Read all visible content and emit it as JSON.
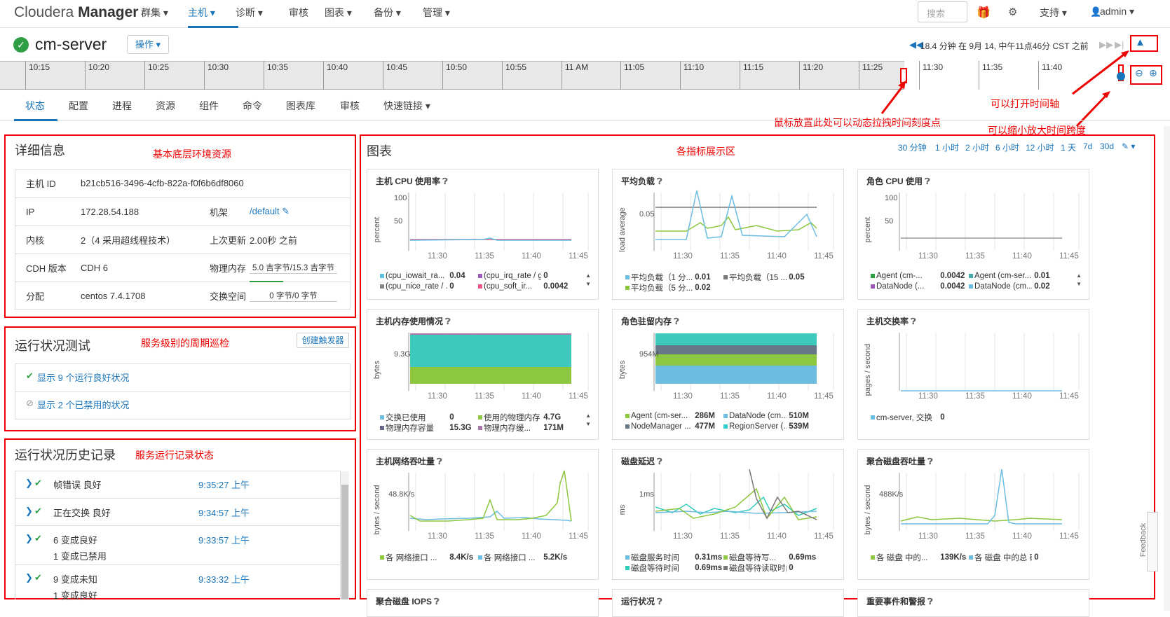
{
  "app": {
    "logo_light": "Cloudera",
    "logo_bold": "Manager"
  },
  "nav": {
    "items": [
      {
        "label": "群集 ▾",
        "active": false
      },
      {
        "label": "主机 ▾",
        "active": true
      },
      {
        "label": "诊断 ▾",
        "active": false
      },
      {
        "label": "审核",
        "active": false
      },
      {
        "label": "图表 ▾",
        "active": false
      },
      {
        "label": "备份 ▾",
        "active": false
      },
      {
        "label": "管理 ▾",
        "active": false
      }
    ],
    "search_placeholder": "搜索",
    "support": "支持 ▾",
    "user": "admin ▾"
  },
  "header": {
    "host": "cm-server",
    "actions": "操作 ▾",
    "time_info": "18.4 分钟 在 9月 14, 中午11点46分 CST 之前"
  },
  "timeline": {
    "ticks": [
      "10:15",
      "10:20",
      "10:25",
      "10:30",
      "10:35",
      "10:40",
      "10:45",
      "10:50",
      "10:55",
      "11 AM",
      "11:05",
      "11:10",
      "11:15",
      "11:20",
      "11:25",
      "11:30",
      "11:35",
      "11:40"
    ]
  },
  "tabs": [
    "状态",
    "配置",
    "进程",
    "资源",
    "组件",
    "命令",
    "图表库",
    "审核",
    "快速链接 ▾"
  ],
  "annotations": {
    "drag": "鼠标放置此处可以动态拉拽时间刻度点",
    "open_timeline": "可以打开时间轴",
    "zoom": "可以缩小放大时间跨度",
    "basic": "基本底层环境资源",
    "metrics": "各指标展示区",
    "periodic": "服务级别的周期巡检",
    "history": "服务运行记录状态"
  },
  "details": {
    "title": "详细信息",
    "rows": [
      {
        "k1": "主机 ID",
        "v1": "b21cb516-3496-4cfb-822a-f0f6b6df8060",
        "k2": "",
        "v2": ""
      },
      {
        "k1": "IP",
        "v1": "172.28.54.188",
        "k2": "机架",
        "v2": "/default ✎"
      },
      {
        "k1": "内核",
        "v1": "2（4 采用超线程技术）",
        "k2": "上次更新",
        "v2": "2.00秒 之前"
      },
      {
        "k1": "CDH 版本",
        "v1": "CDH 6",
        "k2": "物理内存",
        "v2": "5.0 吉字节/15.3 吉字节"
      },
      {
        "k1": "分配",
        "v1": "centos 7.4.1708",
        "k2": "交换空间",
        "v2": "0 字节/0 字节"
      }
    ]
  },
  "health": {
    "title": "运行状况测试",
    "create_trigger": "创建触发器",
    "good": "显示 9 个运行良好状况",
    "disabled": "显示 2 个已禁用的状况"
  },
  "history": {
    "title": "运行状况历史记录",
    "items": [
      {
        "text": "帧错误 良好",
        "sub": "",
        "time": "9:35:27 上午"
      },
      {
        "text": "正在交换 良好",
        "sub": "",
        "time": "9:34:57 上午"
      },
      {
        "text": "6 变成良好",
        "sub": "1 变成已禁用",
        "time": "9:33:57 上午"
      },
      {
        "text": "9 变成未知",
        "sub": "1 变成良好",
        "time": "9:33:32 上午"
      }
    ]
  },
  "charts_panel": {
    "title": "图表",
    "ranges": [
      "30 分钟",
      "1 小时",
      "2 小时",
      "6 小时",
      "12 小时",
      "1 天",
      "7d",
      "30d",
      "✎ ▾"
    ]
  },
  "charts": [
    {
      "title": "主机 CPU 使用率",
      "ylabel": "percent",
      "yticks": [
        "100",
        "50"
      ],
      "legend": [
        [
          "(cpu_iowait_ra...",
          "0.04"
        ],
        [
          "(cpu_irq_rate / ge...",
          "0"
        ],
        [
          "(cpu_nice_rate / ...",
          "0"
        ],
        [
          "(cpu_soft_ir...",
          "0.0042"
        ]
      ]
    },
    {
      "title": "平均负载",
      "ylabel": "load average",
      "yticks": [
        "0.05"
      ],
      "legend": [
        [
          "平均负载（1 分...",
          "0.01"
        ],
        [
          "平均负载（15 ...",
          "0.05"
        ],
        [
          "平均负载（5 分...",
          "0.02"
        ]
      ]
    },
    {
      "title": "角色 CPU 使用",
      "ylabel": "percent",
      "yticks": [
        "100",
        "50"
      ],
      "legend": [
        [
          "Agent (cm-...",
          "0.0042"
        ],
        [
          "Agent (cm-ser...",
          "0.01"
        ],
        [
          "DataNode (...",
          "0.0042"
        ],
        [
          "DataNode (cm...",
          "0.02"
        ]
      ]
    },
    {
      "title": "主机内存使用情况",
      "ylabel": "bytes",
      "yticks": [
        "9.3G"
      ],
      "legend": [
        [
          "交换已使用",
          "0"
        ],
        [
          "使用的物理内存",
          "4.7G"
        ],
        [
          "物理内存容量",
          "15.3G"
        ],
        [
          "物理内存缓...",
          "171M"
        ]
      ]
    },
    {
      "title": "角色驻留内存",
      "ylabel": "bytes",
      "yticks": [
        "954M"
      ],
      "legend": [
        [
          "Agent (cm-ser...",
          "286M"
        ],
        [
          "DataNode (cm...",
          "510M"
        ],
        [
          "NodeManager ...",
          "477M"
        ],
        [
          "RegionServer (...",
          "539M"
        ]
      ]
    },
    {
      "title": "主机交换率",
      "ylabel": "pages / second",
      "yticks": [],
      "legend": [
        [
          "cm-server, 交换",
          "0"
        ]
      ]
    },
    {
      "title": "主机网络吞吐量",
      "ylabel": "bytes / second",
      "yticks": [
        "48.8K/s"
      ],
      "legend": [
        [
          "各 网络接口 ...",
          "8.4K/s"
        ],
        [
          "各 网络接口 ...",
          "5.2K/s"
        ]
      ]
    },
    {
      "title": "磁盘延迟",
      "ylabel": "ms",
      "yticks": [
        "1ms"
      ],
      "legend": [
        [
          "磁盘服务时间",
          "0.31ms"
        ],
        [
          "磁盘等待写...",
          "0.69ms"
        ],
        [
          "磁盘等待时间",
          "0.69ms"
        ],
        [
          "磁盘等待读取时间",
          "0"
        ]
      ]
    },
    {
      "title": "聚合磁盘吞吐量",
      "ylabel": "bytes / second",
      "yticks": [
        "488K/s"
      ],
      "legend": [
        [
          "各 磁盘 中的...",
          "139K/s"
        ],
        [
          "各 磁盘 中的总 磁...",
          "0"
        ]
      ]
    }
  ],
  "xticks": [
    "11:30",
    "11:35",
    "11:40",
    "11:45"
  ],
  "bottom_charts": [
    "聚合磁盘 IOPS",
    "运行状况",
    "重要事件和警报"
  ],
  "feedback": "Feedback"
}
